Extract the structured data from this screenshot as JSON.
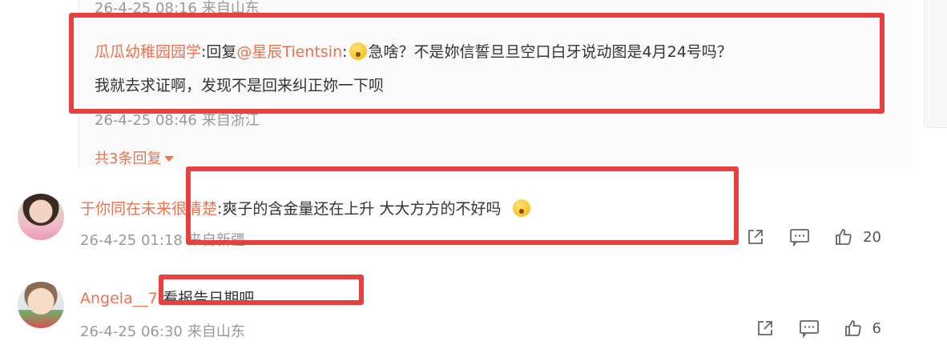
{
  "top_reply": {
    "meta_date": "26-4-25 08:16",
    "meta_source": "来自山东"
  },
  "reply": {
    "author": "瓜瓜幼稚园园学",
    "sep": ":回复",
    "mention": "@星辰Tientsin",
    "colon": ":",
    "emoji": "shocked-face-emoji",
    "text_1": "急啥？不是妳信誓旦旦空口白牙说动图是4月24号吗？",
    "text_2": "我就去求证啊，发现不是回来纠正妳一下呗",
    "meta_date": "26-4-25 08:46",
    "meta_source": "来自浙江"
  },
  "more_replies": {
    "label": "共3条回复"
  },
  "comments": [
    {
      "author": "于你同在未来很清楚",
      "text": ":爽子的含金量还在上升 大大方方的不好吗",
      "emoji": "laugh-cry-emoji",
      "meta_date": "26-4-25 01:18",
      "meta_source": "来自新疆",
      "likes": "20"
    },
    {
      "author": "Angela__7",
      "text": ":看报告日期吧",
      "meta_date": "26-4-25 06:30",
      "meta_source": "来自山东",
      "likes": "6"
    }
  ],
  "colors": {
    "username": "#eb7350",
    "highlight_box": "#e8403f",
    "meta": "#999999",
    "reply_background": "#fafafa"
  }
}
